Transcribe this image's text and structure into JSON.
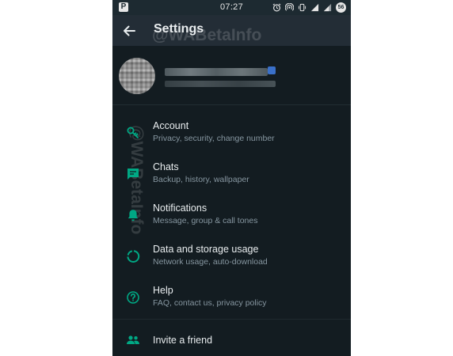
{
  "status_bar": {
    "left_badge": "P",
    "time": "07:27",
    "battery": "56"
  },
  "app_bar": {
    "title": "Settings"
  },
  "watermark": {
    "text": "@WABetaInfo"
  },
  "menu": {
    "items": [
      {
        "title": "Account",
        "subtitle": "Privacy, security, change number",
        "icon": "key-icon"
      },
      {
        "title": "Chats",
        "subtitle": "Backup, history, wallpaper",
        "icon": "chat-icon"
      },
      {
        "title": "Notifications",
        "subtitle": "Message, group & call tones",
        "icon": "bell-icon"
      },
      {
        "title": "Data and storage usage",
        "subtitle": "Network usage, auto-download",
        "icon": "data-usage-icon"
      },
      {
        "title": "Help",
        "subtitle": "FAQ, contact us, privacy policy",
        "icon": "help-icon"
      },
      {
        "title": "Invite a friend",
        "icon": "people-icon"
      }
    ]
  },
  "colors": {
    "background": "#131c21",
    "app_bar": "#232d36",
    "primary_text": "#e9edef",
    "secondary_text": "#8696a0",
    "accent_icon": "#00a884"
  }
}
